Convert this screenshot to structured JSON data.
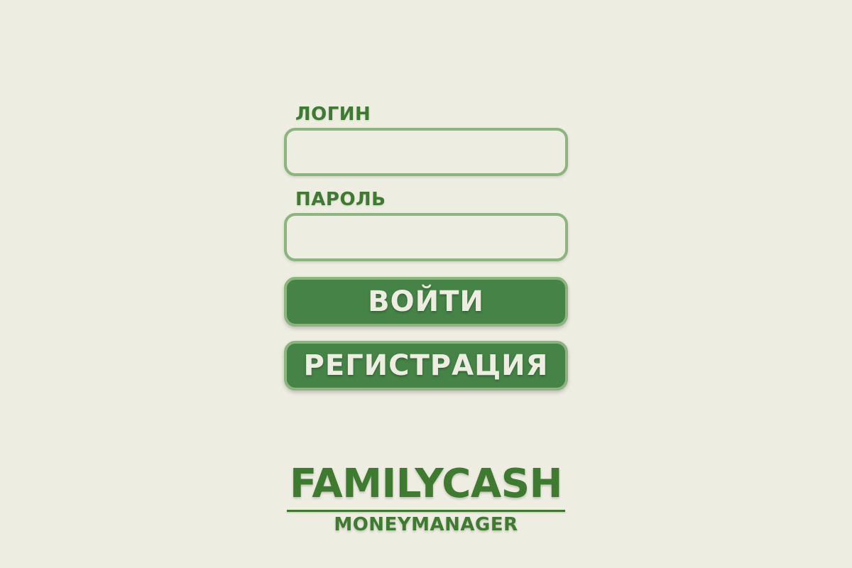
{
  "login_form": {
    "login_label": "ЛОГИН",
    "login_value": "",
    "password_label": "ПАРОЛЬ",
    "password_value": "",
    "submit_label": "ВОЙТИ",
    "register_label": "РЕГИСТРАЦИЯ"
  },
  "logo": {
    "title": "FAMILYCASH",
    "subtitle": "MONEYMANAGER"
  },
  "colors": {
    "background": "#eeede1",
    "accent_green": "#468347",
    "border_green": "#8cb47f",
    "text_green": "#3f7a33"
  }
}
